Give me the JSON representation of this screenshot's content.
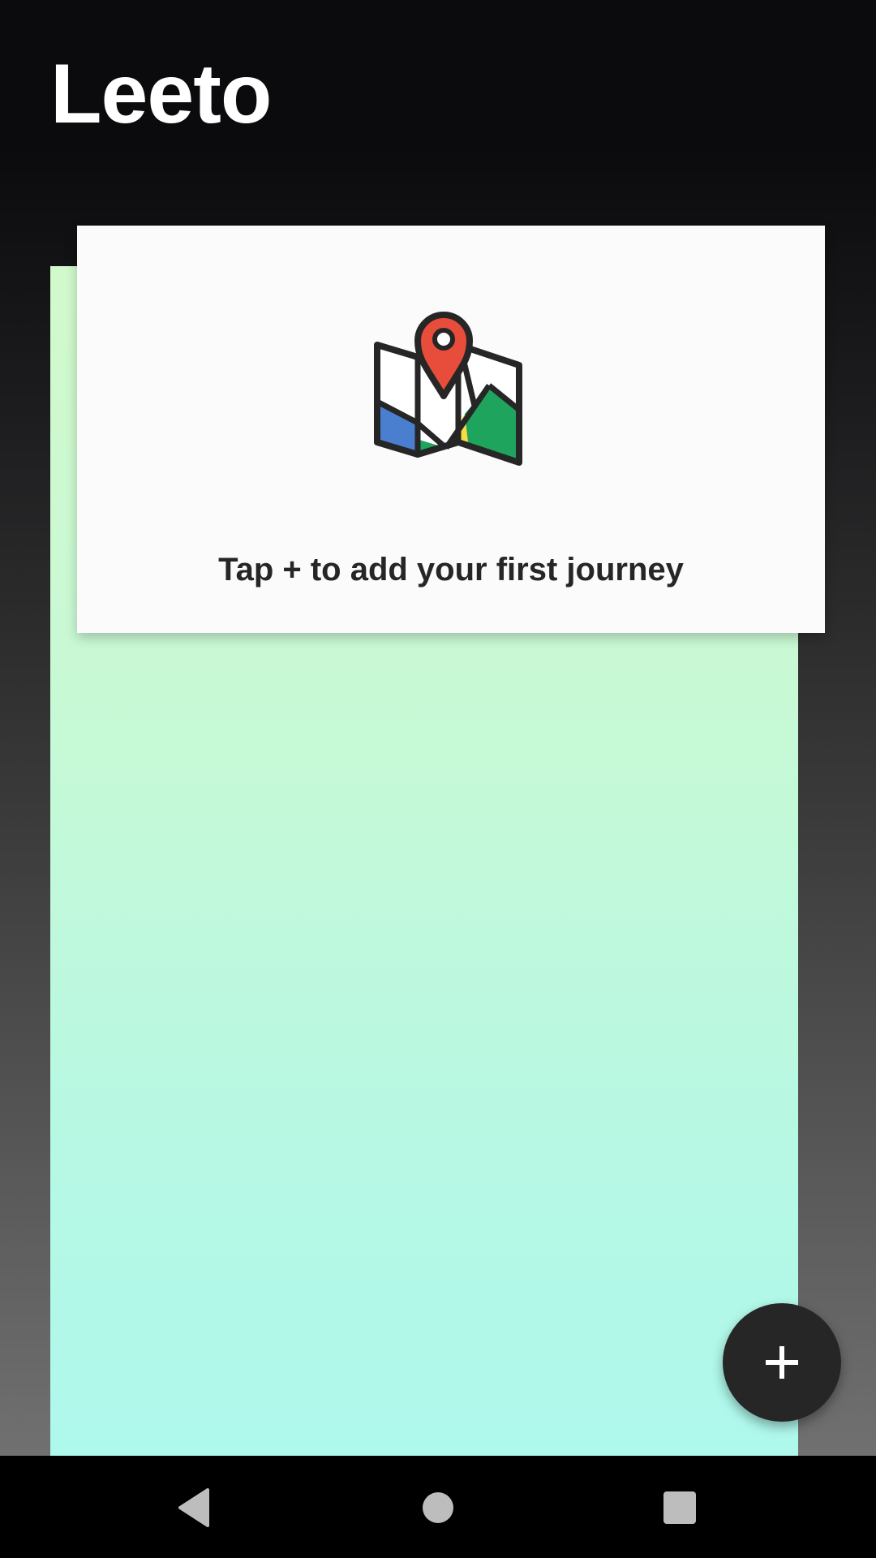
{
  "app": {
    "title": "Leeto"
  },
  "empty_state": {
    "icon": "folded-map-with-pin-icon",
    "message": "Tap + to add your first journey"
  },
  "fab": {
    "icon": "plus-icon",
    "color": "#262626"
  },
  "navigation_bar": {
    "back_icon": "triangle-back-icon",
    "home_icon": "circle-home-icon",
    "recents_icon": "square-recents-icon"
  },
  "colors": {
    "card_background": "#fbfbfb",
    "panel_gradient_top": "#d2f9cc",
    "panel_gradient_bottom": "#aef8ec",
    "map_pin": "#e84d3c",
    "map_blue": "#4a7fd0",
    "map_green": "#1ea45c",
    "map_yellow": "#f7dd42"
  }
}
